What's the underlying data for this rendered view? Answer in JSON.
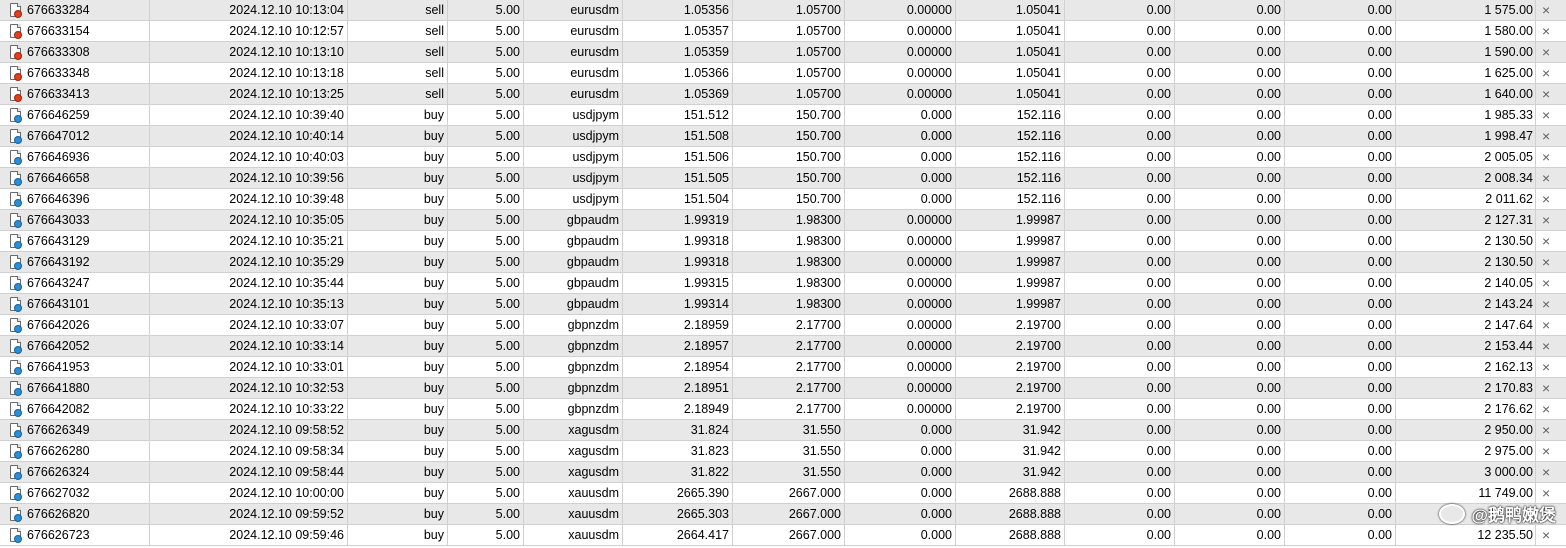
{
  "trades": [
    {
      "ticket": "676633284",
      "time": "2024.12.10 10:13:04",
      "type": "sell",
      "volume": "5.00",
      "symbol": "eurusdm",
      "price": "1.05356",
      "sl": "1.05700",
      "tp": "0.00000",
      "current": "1.05041",
      "commission": "0.00",
      "fee": "0.00",
      "swap": "0.00",
      "profit": "1 575.00"
    },
    {
      "ticket": "676633154",
      "time": "2024.12.10 10:12:57",
      "type": "sell",
      "volume": "5.00",
      "symbol": "eurusdm",
      "price": "1.05357",
      "sl": "1.05700",
      "tp": "0.00000",
      "current": "1.05041",
      "commission": "0.00",
      "fee": "0.00",
      "swap": "0.00",
      "profit": "1 580.00"
    },
    {
      "ticket": "676633308",
      "time": "2024.12.10 10:13:10",
      "type": "sell",
      "volume": "5.00",
      "symbol": "eurusdm",
      "price": "1.05359",
      "sl": "1.05700",
      "tp": "0.00000",
      "current": "1.05041",
      "commission": "0.00",
      "fee": "0.00",
      "swap": "0.00",
      "profit": "1 590.00"
    },
    {
      "ticket": "676633348",
      "time": "2024.12.10 10:13:18",
      "type": "sell",
      "volume": "5.00",
      "symbol": "eurusdm",
      "price": "1.05366",
      "sl": "1.05700",
      "tp": "0.00000",
      "current": "1.05041",
      "commission": "0.00",
      "fee": "0.00",
      "swap": "0.00",
      "profit": "1 625.00"
    },
    {
      "ticket": "676633413",
      "time": "2024.12.10 10:13:25",
      "type": "sell",
      "volume": "5.00",
      "symbol": "eurusdm",
      "price": "1.05369",
      "sl": "1.05700",
      "tp": "0.00000",
      "current": "1.05041",
      "commission": "0.00",
      "fee": "0.00",
      "swap": "0.00",
      "profit": "1 640.00"
    },
    {
      "ticket": "676646259",
      "time": "2024.12.10 10:39:40",
      "type": "buy",
      "volume": "5.00",
      "symbol": "usdjpym",
      "price": "151.512",
      "sl": "150.700",
      "tp": "0.000",
      "current": "152.116",
      "commission": "0.00",
      "fee": "0.00",
      "swap": "0.00",
      "profit": "1 985.33"
    },
    {
      "ticket": "676647012",
      "time": "2024.12.10 10:40:14",
      "type": "buy",
      "volume": "5.00",
      "symbol": "usdjpym",
      "price": "151.508",
      "sl": "150.700",
      "tp": "0.000",
      "current": "152.116",
      "commission": "0.00",
      "fee": "0.00",
      "swap": "0.00",
      "profit": "1 998.47"
    },
    {
      "ticket": "676646936",
      "time": "2024.12.10 10:40:03",
      "type": "buy",
      "volume": "5.00",
      "symbol": "usdjpym",
      "price": "151.506",
      "sl": "150.700",
      "tp": "0.000",
      "current": "152.116",
      "commission": "0.00",
      "fee": "0.00",
      "swap": "0.00",
      "profit": "2 005.05"
    },
    {
      "ticket": "676646658",
      "time": "2024.12.10 10:39:56",
      "type": "buy",
      "volume": "5.00",
      "symbol": "usdjpym",
      "price": "151.505",
      "sl": "150.700",
      "tp": "0.000",
      "current": "152.116",
      "commission": "0.00",
      "fee": "0.00",
      "swap": "0.00",
      "profit": "2 008.34"
    },
    {
      "ticket": "676646396",
      "time": "2024.12.10 10:39:48",
      "type": "buy",
      "volume": "5.00",
      "symbol": "usdjpym",
      "price": "151.504",
      "sl": "150.700",
      "tp": "0.000",
      "current": "152.116",
      "commission": "0.00",
      "fee": "0.00",
      "swap": "0.00",
      "profit": "2 011.62"
    },
    {
      "ticket": "676643033",
      "time": "2024.12.10 10:35:05",
      "type": "buy",
      "volume": "5.00",
      "symbol": "gbpaudm",
      "price": "1.99319",
      "sl": "1.98300",
      "tp": "0.00000",
      "current": "1.99987",
      "commission": "0.00",
      "fee": "0.00",
      "swap": "0.00",
      "profit": "2 127.31"
    },
    {
      "ticket": "676643129",
      "time": "2024.12.10 10:35:21",
      "type": "buy",
      "volume": "5.00",
      "symbol": "gbpaudm",
      "price": "1.99318",
      "sl": "1.98300",
      "tp": "0.00000",
      "current": "1.99987",
      "commission": "0.00",
      "fee": "0.00",
      "swap": "0.00",
      "profit": "2 130.50"
    },
    {
      "ticket": "676643192",
      "time": "2024.12.10 10:35:29",
      "type": "buy",
      "volume": "5.00",
      "symbol": "gbpaudm",
      "price": "1.99318",
      "sl": "1.98300",
      "tp": "0.00000",
      "current": "1.99987",
      "commission": "0.00",
      "fee": "0.00",
      "swap": "0.00",
      "profit": "2 130.50"
    },
    {
      "ticket": "676643247",
      "time": "2024.12.10 10:35:44",
      "type": "buy",
      "volume": "5.00",
      "symbol": "gbpaudm",
      "price": "1.99315",
      "sl": "1.98300",
      "tp": "0.00000",
      "current": "1.99987",
      "commission": "0.00",
      "fee": "0.00",
      "swap": "0.00",
      "profit": "2 140.05"
    },
    {
      "ticket": "676643101",
      "time": "2024.12.10 10:35:13",
      "type": "buy",
      "volume": "5.00",
      "symbol": "gbpaudm",
      "price": "1.99314",
      "sl": "1.98300",
      "tp": "0.00000",
      "current": "1.99987",
      "commission": "0.00",
      "fee": "0.00",
      "swap": "0.00",
      "profit": "2 143.24"
    },
    {
      "ticket": "676642026",
      "time": "2024.12.10 10:33:07",
      "type": "buy",
      "volume": "5.00",
      "symbol": "gbpnzdm",
      "price": "2.18959",
      "sl": "2.17700",
      "tp": "0.00000",
      "current": "2.19700",
      "commission": "0.00",
      "fee": "0.00",
      "swap": "0.00",
      "profit": "2 147.64"
    },
    {
      "ticket": "676642052",
      "time": "2024.12.10 10:33:14",
      "type": "buy",
      "volume": "5.00",
      "symbol": "gbpnzdm",
      "price": "2.18957",
      "sl": "2.17700",
      "tp": "0.00000",
      "current": "2.19700",
      "commission": "0.00",
      "fee": "0.00",
      "swap": "0.00",
      "profit": "2 153.44"
    },
    {
      "ticket": "676641953",
      "time": "2024.12.10 10:33:01",
      "type": "buy",
      "volume": "5.00",
      "symbol": "gbpnzdm",
      "price": "2.18954",
      "sl": "2.17700",
      "tp": "0.00000",
      "current": "2.19700",
      "commission": "0.00",
      "fee": "0.00",
      "swap": "0.00",
      "profit": "2 162.13"
    },
    {
      "ticket": "676641880",
      "time": "2024.12.10 10:32:53",
      "type": "buy",
      "volume": "5.00",
      "symbol": "gbpnzdm",
      "price": "2.18951",
      "sl": "2.17700",
      "tp": "0.00000",
      "current": "2.19700",
      "commission": "0.00",
      "fee": "0.00",
      "swap": "0.00",
      "profit": "2 170.83"
    },
    {
      "ticket": "676642082",
      "time": "2024.12.10 10:33:22",
      "type": "buy",
      "volume": "5.00",
      "symbol": "gbpnzdm",
      "price": "2.18949",
      "sl": "2.17700",
      "tp": "0.00000",
      "current": "2.19700",
      "commission": "0.00",
      "fee": "0.00",
      "swap": "0.00",
      "profit": "2 176.62"
    },
    {
      "ticket": "676626349",
      "time": "2024.12.10 09:58:52",
      "type": "buy",
      "volume": "5.00",
      "symbol": "xagusdm",
      "price": "31.824",
      "sl": "31.550",
      "tp": "0.000",
      "current": "31.942",
      "commission": "0.00",
      "fee": "0.00",
      "swap": "0.00",
      "profit": "2 950.00"
    },
    {
      "ticket": "676626280",
      "time": "2024.12.10 09:58:34",
      "type": "buy",
      "volume": "5.00",
      "symbol": "xagusdm",
      "price": "31.823",
      "sl": "31.550",
      "tp": "0.000",
      "current": "31.942",
      "commission": "0.00",
      "fee": "0.00",
      "swap": "0.00",
      "profit": "2 975.00"
    },
    {
      "ticket": "676626324",
      "time": "2024.12.10 09:58:44",
      "type": "buy",
      "volume": "5.00",
      "symbol": "xagusdm",
      "price": "31.822",
      "sl": "31.550",
      "tp": "0.000",
      "current": "31.942",
      "commission": "0.00",
      "fee": "0.00",
      "swap": "0.00",
      "profit": "3 000.00"
    },
    {
      "ticket": "676627032",
      "time": "2024.12.10 10:00:00",
      "type": "buy",
      "volume": "5.00",
      "symbol": "xauusdm",
      "price": "2665.390",
      "sl": "2667.000",
      "tp": "0.000",
      "current": "2688.888",
      "commission": "0.00",
      "fee": "0.00",
      "swap": "0.00",
      "profit": "11 749.00"
    },
    {
      "ticket": "676626820",
      "time": "2024.12.10 09:59:52",
      "type": "buy",
      "volume": "5.00",
      "symbol": "xauusdm",
      "price": "2665.303",
      "sl": "2667.000",
      "tp": "0.000",
      "current": "2688.888",
      "commission": "0.00",
      "fee": "0.00",
      "swap": "0.00",
      "profit": ""
    },
    {
      "ticket": "676626723",
      "time": "2024.12.10 09:59:46",
      "type": "buy",
      "volume": "5.00",
      "symbol": "xauusdm",
      "price": "2664.417",
      "sl": "2667.000",
      "tp": "0.000",
      "current": "2688.888",
      "commission": "0.00",
      "fee": "0.00",
      "swap": "0.00",
      "profit": "12 235.50"
    }
  ],
  "close_glyph": "×",
  "watermark": "@鹅鸭嫩煲",
  "colors": {
    "row_alt": "#e8e8e8",
    "sell_dot": "#e0401c",
    "buy_dot": "#2a8fd8"
  }
}
